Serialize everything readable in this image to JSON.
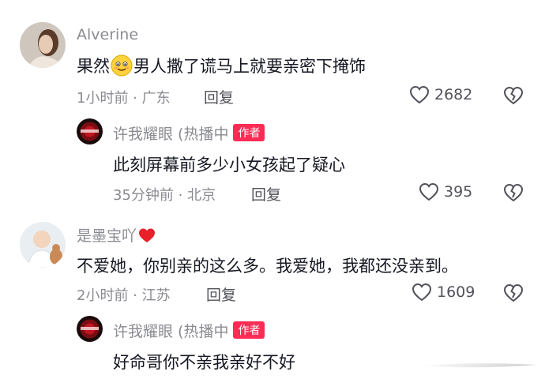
{
  "comments": [
    {
      "username": "Alverine",
      "text_before": "果然",
      "emoji": "smiling-face-emoji",
      "text_after": "男人撒了谎马上就要亲密下掩饰",
      "time": "1小时前",
      "location": "广东",
      "reply_label": "回复",
      "likes": "2682"
    },
    {
      "username": "许我耀眼 (热播中",
      "badge": "作者",
      "text": "此刻屏幕前多少小女孩起了疑心",
      "time": "35分钟前",
      "location": "北京",
      "reply_label": "回复",
      "likes": "395"
    },
    {
      "username": "是墨宝吖",
      "username_icon": "red-heart-icon",
      "text": "不爱她，你别亲的这么多。我爱她，我都还没亲到。",
      "time": "2小时前",
      "location": "江苏",
      "reply_label": "回复",
      "likes": "1609"
    },
    {
      "username": "许我耀眼 (热播中",
      "badge": "作者",
      "text": "好命哥你不亲我亲好不好"
    }
  ],
  "meta_separator": " · ",
  "colors": {
    "author_badge": "#fe2c55",
    "meta": "#8a8b91",
    "text": "#161823"
  }
}
